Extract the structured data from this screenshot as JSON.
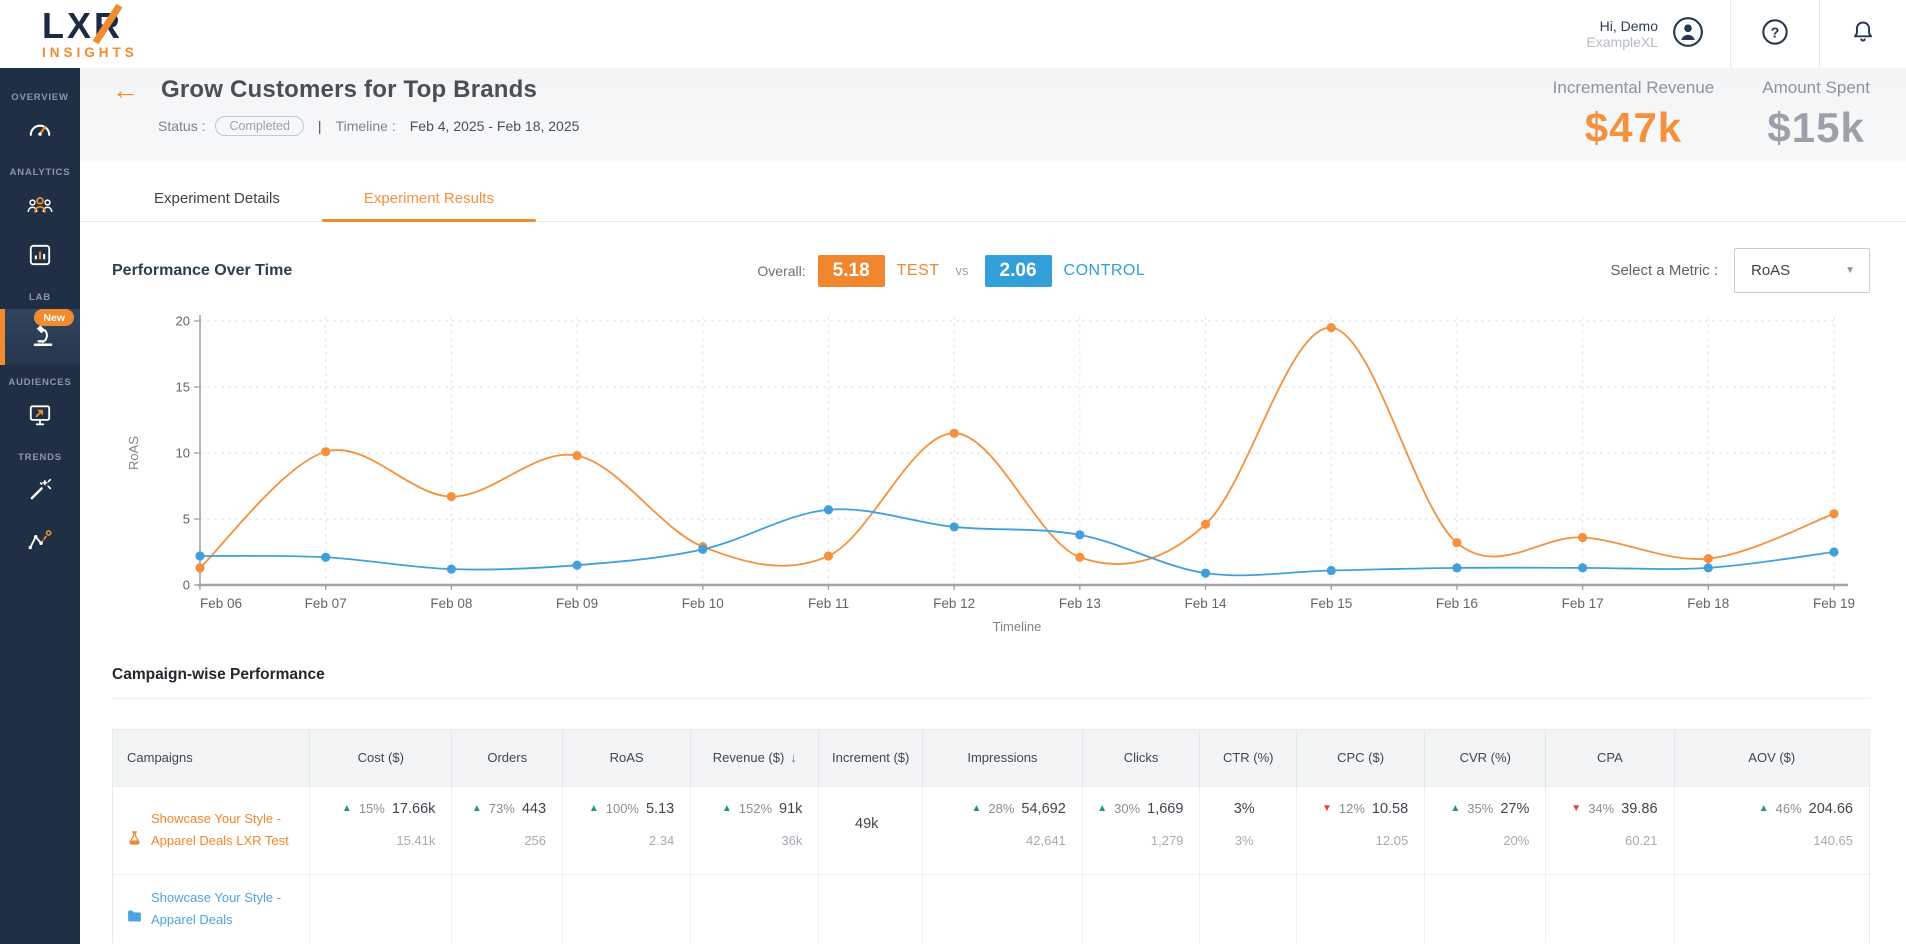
{
  "topbar": {
    "logo_line1": "LXR",
    "logo_line2": "INSIGHTS",
    "user": {
      "greeting": "Hi, Demo",
      "account": "ExampleXL"
    },
    "icons": [
      "user-avatar-icon",
      "help-icon",
      "notifications-icon"
    ]
  },
  "sidebar": {
    "sections": [
      {
        "label": "OVERVIEW",
        "icons": [
          "gauge-icon"
        ]
      },
      {
        "label": "ANALYTICS",
        "icons": [
          "customers-icon",
          "bar-chart-icon"
        ]
      },
      {
        "label": "LAB",
        "icons": [
          "microscope-icon"
        ],
        "badge": "New"
      },
      {
        "label": "AUDIENCES",
        "icons": [
          "monitor-arrow-icon"
        ]
      },
      {
        "label": "TRENDS",
        "icons": [
          "magic-wand-icon",
          "trend-line-icon"
        ]
      }
    ]
  },
  "header": {
    "back_glyph": "←",
    "title": "Grow Customers for Top Brands",
    "status_label": "Status :",
    "status_value": "Completed",
    "separator": "|",
    "timeline_label": "Timeline :",
    "timeline_value": "Feb 4, 2025 - Feb 18, 2025",
    "metrics": [
      {
        "label": "Incremental Revenue",
        "value": "$47k",
        "color": "#f5913d"
      },
      {
        "label": "Amount Spent",
        "value": "$15k",
        "color": "#9aa1a8"
      }
    ]
  },
  "tabs": [
    {
      "label": "Experiment Details",
      "active": false
    },
    {
      "label": "Experiment Results",
      "active": true
    }
  ],
  "performance": {
    "heading": "Performance Over Time",
    "overall_label": "Overall:",
    "test_value": "5.18",
    "test_label": "TEST",
    "vs_label": "vs",
    "control_value": "2.06",
    "control_label": "CONTROL",
    "metric_select_label": "Select a Metric :",
    "metric_select_value": "RoAS"
  },
  "chart_data": {
    "type": "line",
    "title": "Performance Over Time",
    "xlabel": "Timeline",
    "ylabel": "RoAS",
    "ylim": [
      0,
      20
    ],
    "yticks": [
      0,
      5,
      10,
      15,
      20
    ],
    "grid": true,
    "x": [
      "Feb 06",
      "Feb 07",
      "Feb 08",
      "Feb 09",
      "Feb 10",
      "Feb 11",
      "Feb 12",
      "Feb 13",
      "Feb 14",
      "Feb 15",
      "Feb 16",
      "Feb 17",
      "Feb 18",
      "Feb 19"
    ],
    "series": [
      {
        "name": "TEST",
        "color": "#f5913d",
        "values": [
          1.3,
          10.1,
          6.7,
          9.8,
          2.9,
          2.2,
          11.5,
          2.1,
          4.6,
          19.5,
          3.2,
          3.6,
          2.0,
          5.4
        ]
      },
      {
        "name": "CONTROL",
        "color": "#41a0dc",
        "values": [
          2.2,
          2.1,
          1.2,
          1.5,
          2.7,
          5.7,
          4.4,
          3.8,
          0.9,
          1.1,
          1.3,
          1.3,
          1.3,
          2.5
        ]
      }
    ]
  },
  "table": {
    "heading": "Campaign-wise Performance",
    "columns": [
      {
        "label": "Campaigns",
        "key": "campaign"
      },
      {
        "label": "Cost ($)",
        "key": "cost"
      },
      {
        "label": "Orders",
        "key": "orders"
      },
      {
        "label": "RoAS",
        "key": "roas"
      },
      {
        "label": "Revenue ($)",
        "key": "revenue",
        "sorted": "desc"
      },
      {
        "label": "Increment ($)",
        "key": "increment"
      },
      {
        "label": "Impressions",
        "key": "impressions"
      },
      {
        "label": "Clicks",
        "key": "clicks"
      },
      {
        "label": "CTR (%)",
        "key": "ctr"
      },
      {
        "label": "CPC ($)",
        "key": "cpc"
      },
      {
        "label": "CVR (%)",
        "key": "cvr"
      },
      {
        "label": "CPA",
        "key": "cpa"
      },
      {
        "label": "AOV ($)",
        "key": "aov"
      }
    ],
    "rows": [
      {
        "campaign": "Showcase Your Style - Apparel Deals LXR Test",
        "icon": "flask-icon",
        "link_color": "#f0862e",
        "cells": {
          "cost": {
            "dir": "up",
            "pct": "15%",
            "value": "17.66k",
            "sub": "15.41k"
          },
          "orders": {
            "dir": "up",
            "pct": "73%",
            "value": "443",
            "sub": "256"
          },
          "roas": {
            "dir": "up",
            "pct": "100%",
            "value": "5.13",
            "sub": "2.34"
          },
          "revenue": {
            "dir": "up",
            "pct": "152%",
            "value": "91k",
            "sub": "36k"
          },
          "increment": {
            "value": "49k",
            "center": true,
            "single": true
          },
          "impressions": {
            "dir": "up",
            "pct": "28%",
            "value": "54,692",
            "sub": "42,641"
          },
          "clicks": {
            "dir": "up",
            "pct": "30%",
            "value": "1,669",
            "sub": "1,279"
          },
          "ctr": {
            "value": "3%",
            "sub": "3%",
            "center": true
          },
          "cpc": {
            "dir": "down",
            "pct": "12%",
            "value": "10.58",
            "sub": "12.05"
          },
          "cvr": {
            "dir": "up",
            "pct": "35%",
            "value": "27%",
            "sub": "20%"
          },
          "cpa": {
            "dir": "down",
            "pct": "34%",
            "value": "39.86",
            "sub": "60.21"
          },
          "aov": {
            "dir": "up",
            "pct": "46%",
            "value": "204.66",
            "sub": "140.65"
          }
        }
      },
      {
        "campaign": "Showcase Your Style - Apparel Deals",
        "icon": "folder-icon",
        "link_color": "#4da3e0",
        "cells": {}
      }
    ]
  }
}
